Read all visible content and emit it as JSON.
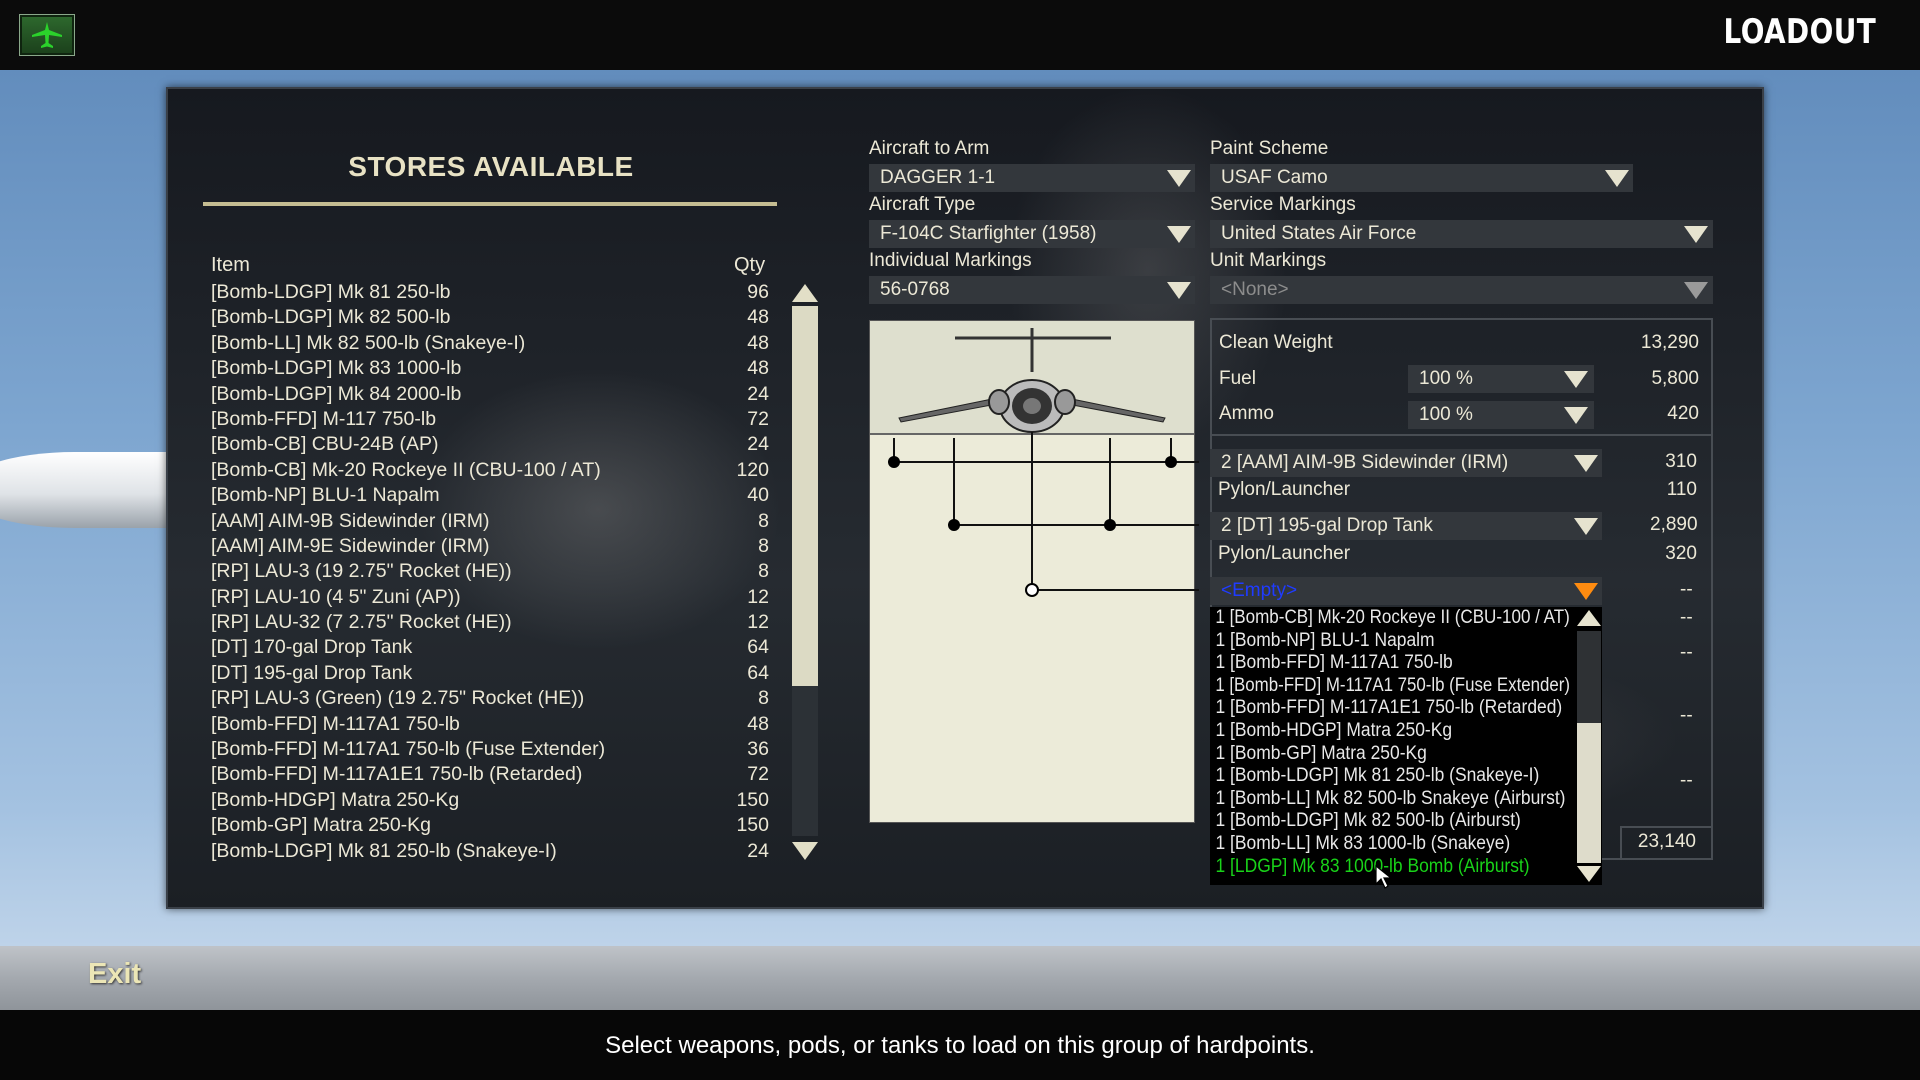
{
  "header": {
    "title": "LOADOUT",
    "home_icon": "aircraft-icon"
  },
  "stores": {
    "title": "STORES AVAILABLE",
    "col_item": "Item",
    "col_qty": "Qty",
    "items": [
      {
        "name": "[Bomb-LDGP] Mk 81 250-lb",
        "qty": "96"
      },
      {
        "name": "[Bomb-LDGP] Mk 82 500-lb",
        "qty": "48"
      },
      {
        "name": "[Bomb-LL] Mk 82 500-lb (Snakeye-I)",
        "qty": "48"
      },
      {
        "name": "[Bomb-LDGP] Mk 83 1000-lb",
        "qty": "48"
      },
      {
        "name": "[Bomb-LDGP] Mk 84 2000-lb",
        "qty": "24"
      },
      {
        "name": "[Bomb-FFD] M-117 750-lb",
        "qty": "72"
      },
      {
        "name": "[Bomb-CB] CBU-24B (AP)",
        "qty": "24"
      },
      {
        "name": "[Bomb-CB] Mk-20 Rockeye II (CBU-100 / AT)",
        "qty": "120"
      },
      {
        "name": "[Bomb-NP] BLU-1 Napalm",
        "qty": "40"
      },
      {
        "name": "[AAM] AIM-9B Sidewinder (IRM)",
        "qty": "8"
      },
      {
        "name": "[AAM] AIM-9E Sidewinder (IRM)",
        "qty": "8"
      },
      {
        "name": "[RP] LAU-3 (19 2.75\" Rocket (HE))",
        "qty": "8"
      },
      {
        "name": "[RP] LAU-10 (4 5\" Zuni (AP))",
        "qty": "12"
      },
      {
        "name": "[RP] LAU-32 (7 2.75\" Rocket (HE))",
        "qty": "12"
      },
      {
        "name": "[DT] 170-gal Drop Tank",
        "qty": "64"
      },
      {
        "name": "[DT] 195-gal Drop Tank",
        "qty": "64"
      },
      {
        "name": "[RP] LAU-3 (Green) (19 2.75\" Rocket (HE))",
        "qty": "8"
      },
      {
        "name": "[Bomb-FFD] M-117A1 750-lb",
        "qty": "48"
      },
      {
        "name": "[Bomb-FFD] M-117A1 750-lb (Fuse Extender)",
        "qty": "36"
      },
      {
        "name": "[Bomb-FFD] M-117A1E1 750-lb (Retarded)",
        "qty": "72"
      },
      {
        "name": "[Bomb-HDGP] Matra 250-Kg",
        "qty": "150"
      },
      {
        "name": "[Bomb-GP] Matra 250-Kg",
        "qty": "150"
      },
      {
        "name": "[Bomb-LDGP] Mk 81 250-lb (Snakeye-I)",
        "qty": "24"
      }
    ]
  },
  "config": {
    "aircraft_to_arm": {
      "label": "Aircraft to Arm",
      "value": "DAGGER 1-1"
    },
    "aircraft_type": {
      "label": "Aircraft Type",
      "value": "F-104C Starfighter (1958)"
    },
    "individual_markings": {
      "label": "Individual Markings",
      "value": "56-0768"
    },
    "paint_scheme": {
      "label": "Paint Scheme",
      "value": "USAF Camo"
    },
    "service_markings": {
      "label": "Service Markings",
      "value": "United States Air Force"
    },
    "unit_markings": {
      "label": "Unit Markings",
      "value": "<None>"
    }
  },
  "weights": {
    "clean_weight": {
      "label": "Clean Weight",
      "value": "13,290"
    },
    "fuel": {
      "label": "Fuel",
      "setting": "100 %",
      "value": "5,800"
    },
    "ammo": {
      "label": "Ammo",
      "setting": "100 %",
      "value": "420"
    },
    "total": "23,140"
  },
  "hardpoints": [
    {
      "store": "2 [AAM] AIM-9B Sidewinder (IRM)",
      "store_weight": "310",
      "pylon_label": "Pylon/Launcher",
      "pylon_weight": "110"
    },
    {
      "store": "2 [DT] 195-gal Drop Tank",
      "store_weight": "2,890",
      "pylon_label": "Pylon/Launcher",
      "pylon_weight": "320"
    },
    {
      "store": "<Empty>",
      "store_weight": "--"
    }
  ],
  "empty_dashes": [
    "--",
    "--",
    "--",
    "--"
  ],
  "dropdown_list": [
    "1 [Bomb-CB] Mk-20 Rockeye II (CBU-100 / AT)",
    "1 [Bomb-NP] BLU-1 Napalm",
    "1 [Bomb-FFD] M-117A1 750-lb",
    "1 [Bomb-FFD] M-117A1 750-lb (Fuse Extender)",
    "1 [Bomb-FFD] M-117A1E1 750-lb (Retarded)",
    "1 [Bomb-HDGP] Matra 250-Kg",
    "1 [Bomb-GP] Matra 250-Kg",
    "1 [Bomb-LDGP] Mk 81 250-lb (Snakeye-I)",
    "1 [Bomb-LL] Mk 82 500-lb Snakeye (Airburst)",
    "1 [Bomb-LDGP] Mk 82 500-lb (Airburst)",
    "1 [Bomb-LL] Mk 83 1000-lb (Snakeye)",
    "1 [LDGP] Mk 83 1000-lb Bomb (Airburst)"
  ],
  "dropdown_highlight_index": 11,
  "footer": {
    "exit_label": "Exit",
    "hint": "Select weapons, pods, or tanks to load on this group of hardpoints."
  },
  "colors": {
    "highlight": "#19d219",
    "accent": "#ff8c10",
    "selected_text": "#1f3bff",
    "title": "#e8e2c4"
  }
}
